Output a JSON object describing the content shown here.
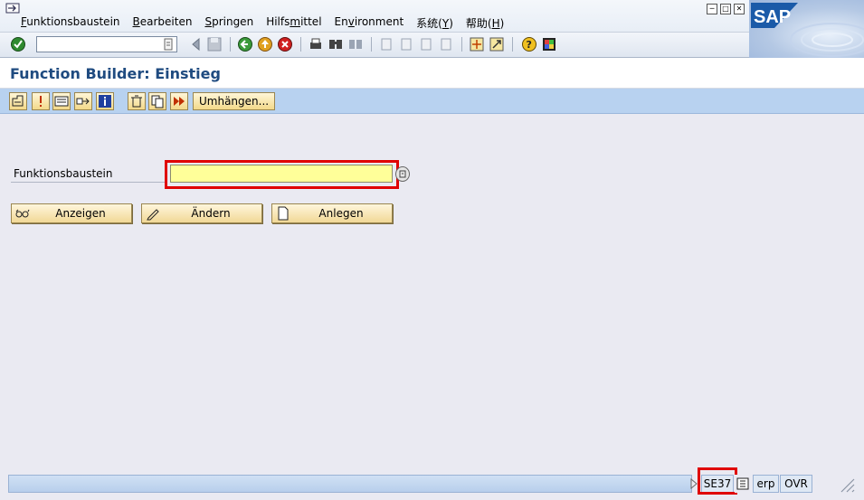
{
  "menubar": {
    "items": [
      {
        "label": "Funktionsbaustein",
        "mnemonic": "F",
        "rest": "unktionsbaustein"
      },
      {
        "label": "Bearbeiten",
        "mnemonic": "B",
        "rest": "earbeiten"
      },
      {
        "label": "Springen",
        "mnemonic": "S",
        "rest": "pringen"
      },
      {
        "label": "Hilfsmittel",
        "pre": "Hilfs",
        "mnemonic": "m",
        "rest": "ittel"
      },
      {
        "label": "Environment",
        "pre": "En",
        "mnemonic": "v",
        "rest": "ironment"
      },
      {
        "label": "系统(Y)",
        "pre": "系统(",
        "mnemonic": "Y",
        "rest": ")"
      },
      {
        "label": "帮助(H)",
        "pre": "帮助(",
        "mnemonic": "H",
        "rest": ")"
      }
    ],
    "window_controls": [
      "minimize",
      "maximize",
      "close"
    ]
  },
  "logo": {
    "text": "SAP",
    "color": "#ffffff",
    "background": "#1a5aa8"
  },
  "std_toolbar": {
    "okcode_value": "",
    "icons": [
      "enter-icon",
      "back-arrow-icon",
      "save-icon",
      "green-back-icon",
      "exit-icon",
      "cancel-icon",
      "print-icon",
      "find-icon",
      "find-next-icon",
      "first-page-icon",
      "previous-page-icon",
      "next-page-icon",
      "last-page-icon",
      "create-session-icon",
      "shortcut-icon",
      "help-icon",
      "layout-menu-icon"
    ]
  },
  "title": "Function Builder: Einstieg",
  "app_toolbar": {
    "icons": [
      "where-used-icon",
      "activate-icon",
      "display-object-list-icon",
      "other-object-icon",
      "info-icon",
      "delete-icon",
      "copy-icon",
      "test-execute-icon"
    ],
    "reassign_label": "Umhängen..."
  },
  "form": {
    "label": "Funktionsbaustein",
    "value": ""
  },
  "actions": {
    "display_label": "Anzeigen",
    "change_label": "Ändern",
    "create_label": "Anlegen"
  },
  "status": {
    "message": "",
    "transaction": "SE37",
    "system": "erp",
    "mode": "OVR"
  },
  "colors": {
    "title": "#1f4b80",
    "app_toolbar": "#b8d2f0",
    "required_field": "#ffff99",
    "highlight": "#e00000",
    "button": "#f1d896"
  }
}
